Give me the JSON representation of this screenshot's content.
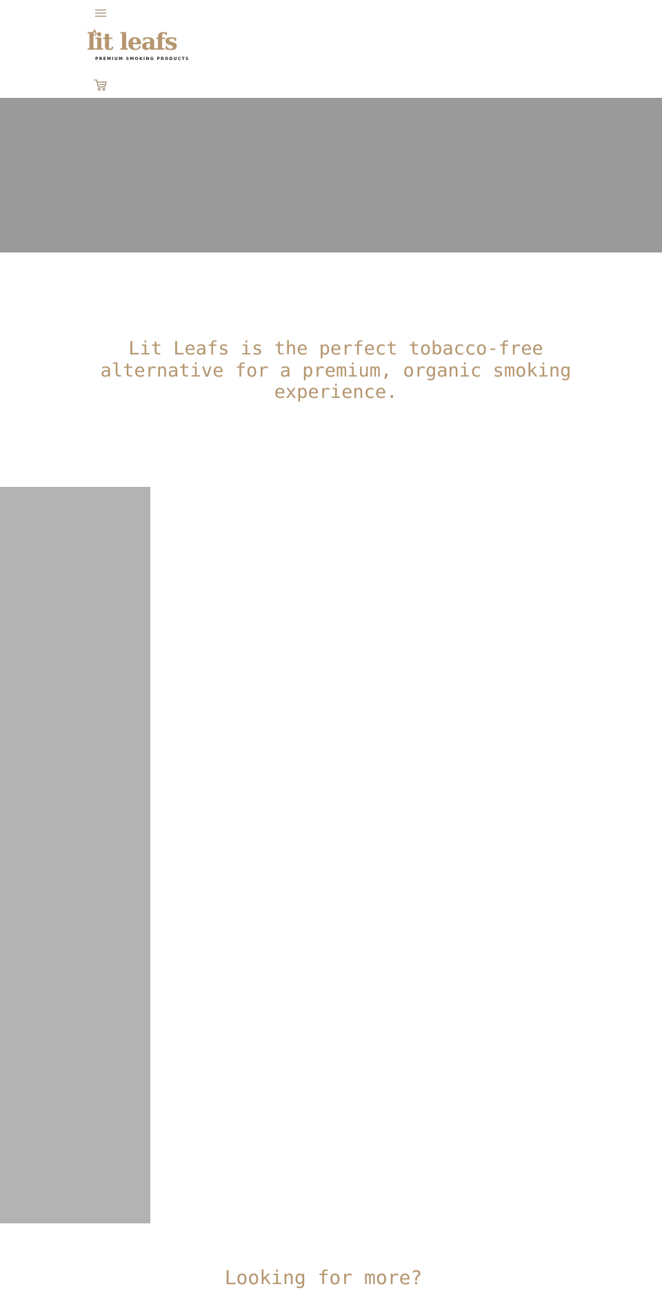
{
  "header": {
    "menu_icon": "hamburger-menu-icon",
    "logo": {
      "wordmark": "lit leafs",
      "tagline": "PREMIUM SMOKING PRODUCTS"
    },
    "cart_icon": "shopping-cart-icon"
  },
  "hero": {
    "image": "hero-image-placeholder"
  },
  "intro": {
    "tagline": "Lit Leafs is the perfect tobacco-free alternative for a premium, organic smoking experience."
  },
  "feature": {
    "image": "side-image-placeholder"
  },
  "more": {
    "heading": "Looking for more?"
  },
  "colors": {
    "accent": "#b59670",
    "hero_placeholder": "#9a9a9a",
    "side_placeholder": "#b3b3b3",
    "background": "#ffffff"
  }
}
